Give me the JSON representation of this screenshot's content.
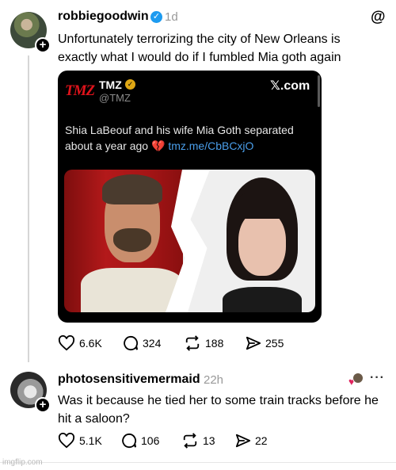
{
  "post1": {
    "username": "robbiegoodwin",
    "time": "1d",
    "text": "Unfortunately terrorizing the city of New Orleans  is exactly what I would do if I fumbled Mia goth again",
    "actions": {
      "likes": "6.6K",
      "comments": "324",
      "reposts": "188",
      "shares": "255"
    }
  },
  "card": {
    "logo": "TMZ",
    "name": "TMZ",
    "handle": "@TMZ",
    "source": "𝕏.com",
    "text": "Shia LaBeouf and his wife Mia Goth separated about a year ago ",
    "emoji": "💔",
    "link": "tmz.me/CbBCxjO"
  },
  "post2": {
    "username": "photosensitivemermaid",
    "time": "22h",
    "text": "Was it because he tied her to some train tracks before he hit a saloon?",
    "actions": {
      "likes": "5.1K",
      "comments": "106",
      "reposts": "13",
      "shares": "22"
    }
  },
  "watermark": "imgflip.com",
  "colors": {
    "verified": "#1d9bf0",
    "tmz_red": "#e0131b",
    "link": "#4a9eea",
    "heart": "#e0245e"
  }
}
